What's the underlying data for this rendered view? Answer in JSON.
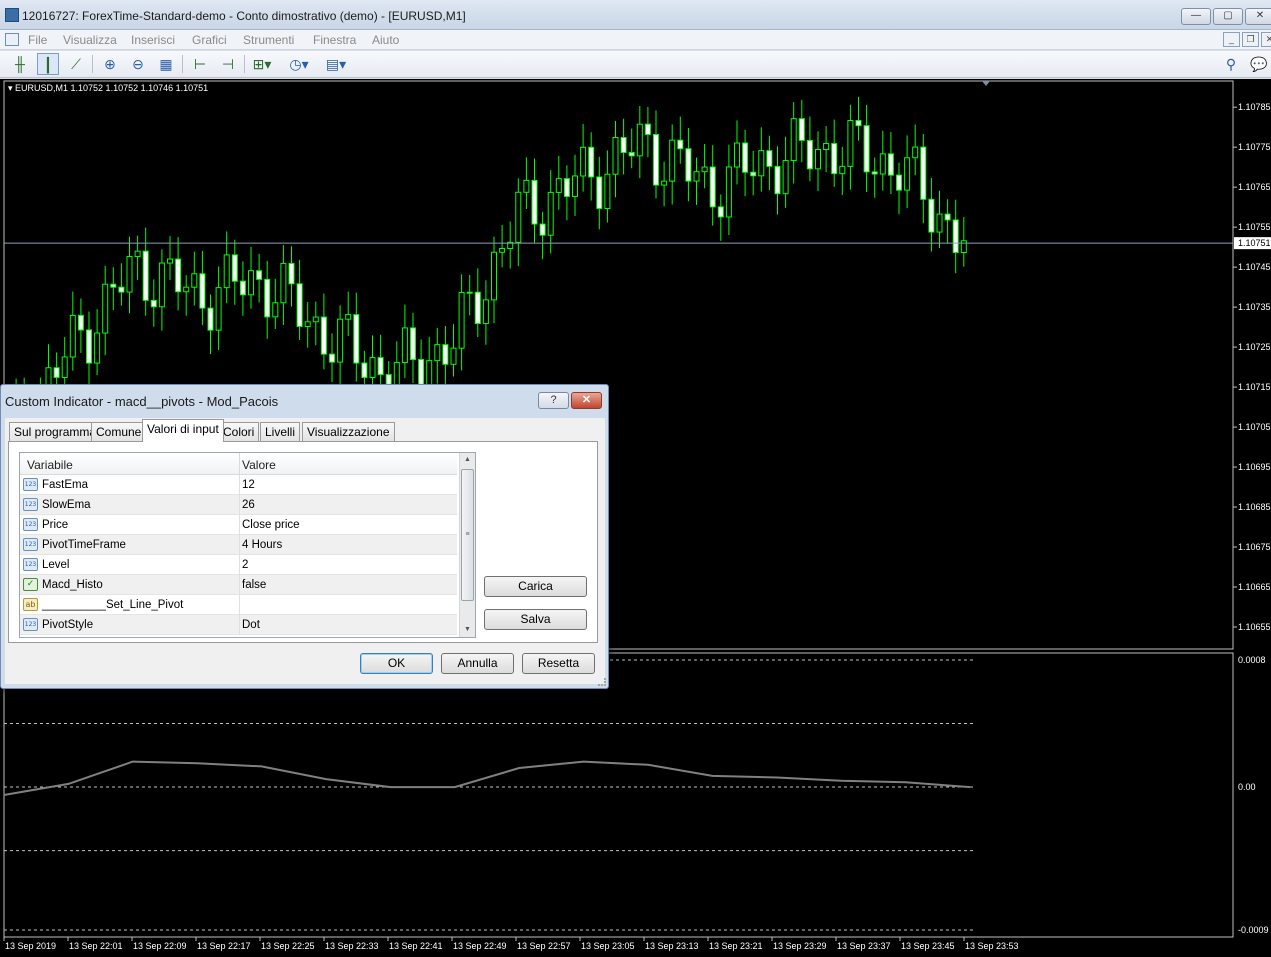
{
  "window": {
    "title": "12016727: ForexTime-Standard-demo - Conto dimostrativo (demo) - [EURUSD,M1]",
    "buttons": [
      "—",
      "▢",
      "✕"
    ]
  },
  "menu": {
    "items": [
      "File",
      "Visualizza",
      "Inserisci",
      "Grafici",
      "Strumenti",
      "Finestra",
      "Aiuto"
    ]
  },
  "toolbar": {
    "icons": [
      "bar-chart-icon",
      "candlestick-icon",
      "line-chart-icon",
      "zoom-in-icon",
      "zoom-out-icon",
      "tile-windows-icon",
      "chart-shift-icon",
      "autoscroll-icon",
      "indicators-icon",
      "periods-icon",
      "templates-icon"
    ],
    "right_icons": [
      "search-icon",
      "chat-icon"
    ]
  },
  "chart": {
    "symbol_label": "EURUSD,M1",
    "ohlc": "1.10752 1.10752 1.10746 1.10751",
    "price_current": "1.10751",
    "colors": {
      "background": "#000000",
      "candle": "#00ff00",
      "bull_body": "#000000",
      "bear_body": "#ffffff",
      "current_line": "#8aa2c0",
      "macd_line": "#808080",
      "level": "#c0c0c0"
    },
    "price_ticks": [
      "1.10785",
      "1.10775",
      "1.10765",
      "1.10755",
      "1.10745",
      "1.10735",
      "1.10725",
      "1.10715",
      "1.10705",
      "1.10695",
      "1.10685",
      "1.10675",
      "1.10665",
      "1.10655"
    ],
    "macd_ticks": [
      "0.0008",
      "0.00",
      "-0.0009"
    ],
    "time_ticks": [
      "13 Sep 2019",
      "13 Sep 22:01",
      "13 Sep 22:09",
      "13 Sep 22:17",
      "13 Sep 22:25",
      "13 Sep 22:33",
      "13 Sep 22:41",
      "13 Sep 22:49",
      "13 Sep 22:57",
      "13 Sep 23:05",
      "13 Sep 23:13",
      "13 Sep 23:21",
      "13 Sep 23:29",
      "13 Sep 23:37",
      "13 Sep 23:45",
      "13 Sep 23:53"
    ]
  },
  "chart_data": {
    "type": "candlestick",
    "symbol": "EURUSD",
    "timeframe": "M1",
    "ylim": [
      1.10655,
      1.1079
    ],
    "x": [
      "13 Sep 2019",
      "13 Sep 22:01",
      "13 Sep 22:09",
      "13 Sep 22:17",
      "13 Sep 22:25",
      "13 Sep 22:33",
      "13 Sep 22:41",
      "13 Sep 22:49",
      "13 Sep 22:57",
      "13 Sep 23:05",
      "13 Sep 23:13",
      "13 Sep 23:21",
      "13 Sep 23:29",
      "13 Sep 23:37",
      "13 Sep 23:45",
      "13 Sep 23:53"
    ],
    "close": [
      1.107,
      1.10725,
      1.10745,
      1.10738,
      1.10742,
      1.10728,
      1.10718,
      1.10726,
      1.10758,
      1.10767,
      1.10776,
      1.10765,
      1.10772,
      1.10775,
      1.1077,
      1.10751
    ],
    "macd": {
      "ylim": [
        -0.0009,
        0.0008
      ],
      "levels": [
        0.0008,
        0.0004,
        0.0,
        -0.0004,
        -0.0009
      ],
      "values": [
        -5e-05,
        2e-05,
        0.00016,
        0.00015,
        0.00013,
        5e-05,
        0.0,
        0.0,
        0.00012,
        0.00016,
        0.00014,
        7e-05,
        6e-05,
        4e-05,
        3e-05,
        0.0
      ]
    }
  },
  "dialog": {
    "title": "Custom Indicator - macd__pivots - Mod_Pacois",
    "help": "?",
    "close": "✕",
    "tabs": [
      "Sul programma",
      "Comune",
      "Valori di input",
      "Colori",
      "Livelli",
      "Visualizzazione"
    ],
    "active_tab": "Valori di input",
    "columns": [
      "Variabile",
      "Valore"
    ],
    "rows": [
      {
        "icon": "123",
        "name": "FastEma",
        "value": "12"
      },
      {
        "icon": "123",
        "name": "SlowEma",
        "value": "26"
      },
      {
        "icon": "123",
        "name": "Price",
        "value": "Close price"
      },
      {
        "icon": "123",
        "name": "PivotTimeFrame",
        "value": "4 Hours"
      },
      {
        "icon": "123",
        "name": "Level",
        "value": "2"
      },
      {
        "icon": "✓",
        "name": "Macd_Histo",
        "value": "false"
      },
      {
        "icon": "ab",
        "name": "__________Set_Line_Pivot",
        "value": ""
      },
      {
        "icon": "123",
        "name": "PivotStyle",
        "value": "Dot"
      }
    ],
    "side_buttons": {
      "load": "Carica",
      "save": "Salva"
    },
    "buttons": {
      "ok": "OK",
      "cancel": "Annulla",
      "reset": "Resetta"
    }
  }
}
